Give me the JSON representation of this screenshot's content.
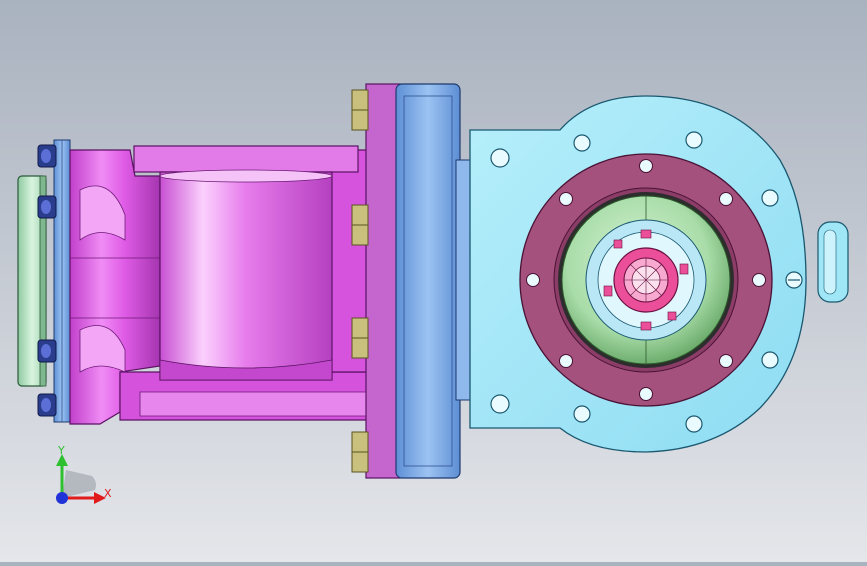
{
  "viewport": {
    "model_name": "",
    "background_top": "#a9b2bf",
    "background_bottom": "#e4e6ea"
  },
  "colors": {
    "housing_magenta": "#e05ce6",
    "housing_magenta_dark": "#9a2aa6",
    "housing_magenta_light": "#f7b4fa",
    "plate_blue": "#78a8e6",
    "plate_blue_dark": "#3f6fb4",
    "gearbox_cyan": "#9fe6f7",
    "gearbox_cyan_dark": "#5bb4d0",
    "ring_mauve": "#a4517e",
    "ring_mauve_dark": "#6a2650",
    "hub_green": "#a8dca8",
    "hub_green_dark": "#4a8a4a",
    "flange_green": "#bfe8c9",
    "bolt_navy": "#2a3c8c",
    "nut_gold": "#c8c07c",
    "spline_pink": "#ec4f9a"
  },
  "triad": {
    "x_label": "X",
    "y_label": "Y",
    "x_color": "#e11b1b",
    "y_color": "#2fc02f",
    "origin_color": "#1f33d6"
  }
}
